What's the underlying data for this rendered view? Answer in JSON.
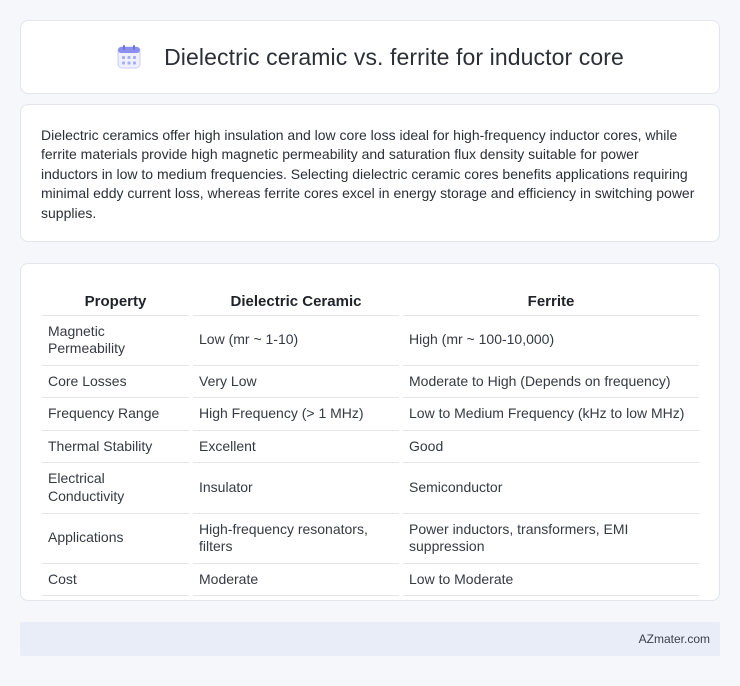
{
  "header": {
    "icon": "calendar-icon",
    "title": "Dielectric ceramic vs. ferrite for inductor core"
  },
  "summary": "Dielectric ceramics offer high insulation and low core loss ideal for high-frequency inductor cores, while ferrite materials provide high magnetic permeability and saturation flux density suitable for power inductors in low to medium frequencies. Selecting dielectric ceramic cores benefits applications requiring minimal eddy current loss, whereas ferrite cores excel in energy storage and efficiency in switching power supplies.",
  "table": {
    "headers": [
      "Property",
      "Dielectric Ceramic",
      "Ferrite"
    ],
    "rows": [
      [
        "Magnetic Permeability",
        "Low (mr ~ 1-10)",
        "High (mr ~ 100-10,000)"
      ],
      [
        "Core Losses",
        "Very Low",
        "Moderate to High (Depends on frequency)"
      ],
      [
        "Frequency Range",
        "High Frequency (> 1 MHz)",
        "Low to Medium Frequency (kHz to low MHz)"
      ],
      [
        "Thermal Stability",
        "Excellent",
        "Good"
      ],
      [
        "Electrical Conductivity",
        "Insulator",
        "Semiconductor"
      ],
      [
        "Applications",
        "High-frequency resonators, filters",
        "Power inductors, transformers, EMI suppression"
      ],
      [
        "Cost",
        "Moderate",
        "Low to Moderate"
      ]
    ]
  },
  "footer": {
    "brand": "AZmater.com"
  },
  "colors": {
    "background": "#f6f7fb",
    "card": "#ffffff",
    "footer": "#e9edf7",
    "icon_accent": "#8a8ff0"
  }
}
